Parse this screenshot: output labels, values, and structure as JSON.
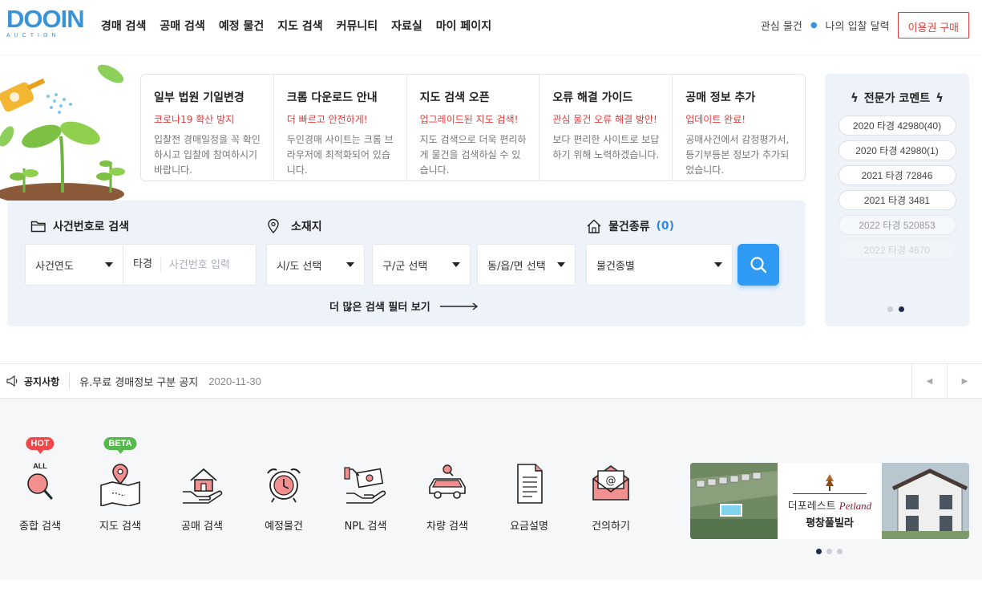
{
  "header": {
    "logo_text": "DOOIN",
    "logo_sub": "AUCTION",
    "nav": [
      "경매 검색",
      "공매 검색",
      "예정 물건",
      "지도 검색",
      "커뮤니티",
      "자료실",
      "마이 페이지"
    ],
    "link_favorites": "관심 물건",
    "link_calendar": "나의 입찰 달력",
    "buy_button": "이용권 구매"
  },
  "notice_cards": [
    {
      "title": "일부 법원 기일변경",
      "sub": "코로나19 확산 방지",
      "body": "입찰전 경매일정을 꼭 확인하시고 입찰에 참여하시기 바랍니다."
    },
    {
      "title": "크롬 다운로드 안내",
      "sub": "더 빠르고 안전하게!",
      "body": "두인경매 사이트는 크롬 브라우저에 최적화되어 있습니다."
    },
    {
      "title": "지도 검색 오픈",
      "sub": "업그레이드된 지도 검색!",
      "body": "지도 검색으로 더욱 편리하게 물건을 검색하실 수 있습니다."
    },
    {
      "title": "오류 해결 가이드",
      "sub": "관심 물건 오류 해결 방안!",
      "body": "보다 편리한 사이트로 보답하기 위해 노력하겠습니다."
    },
    {
      "title": "공매 정보 추가",
      "sub": "업데이트 완료!",
      "body": "공매사건에서 감정평가서, 등기부등본 정보가 추가되었습니다."
    }
  ],
  "expert": {
    "title": "전문가 코멘트",
    "cases": [
      "2020 타경 42980(40)",
      "2020 타경 42980(1)",
      "2021 타경 72846",
      "2021 타경 3481",
      "2022 타경 520853",
      "2022 타경 4670"
    ],
    "pager_active": 2,
    "pager_total": 2
  },
  "search": {
    "case_label": "사건번호로 검색",
    "location_label": "소재지",
    "type_label": "물건종류",
    "type_count": "(0)",
    "year_select": "사건연도",
    "tagyeong": "타경",
    "case_placeholder": "사건번호 입력",
    "sido_select": "시/도 선택",
    "gugun_select": "구/군 선택",
    "dong_select": "동/읍/면 선택",
    "type_select": "물건종별",
    "more_filters": "더 많은 검색 필터 보기"
  },
  "notice_bar": {
    "label": "공지사항",
    "text": "유.무료 경매정보 구분 공지",
    "date": "2020-11-30"
  },
  "quick_menu": {
    "badge_hot": "HOT",
    "badge_beta": "BETA",
    "all_text": "ALL",
    "items": [
      "종합 검색",
      "지도 검색",
      "공매 검색",
      "예정물건",
      "NPL 검색",
      "차량 검색",
      "요금설명",
      "건의하기"
    ]
  },
  "banner": {
    "brand_kr": "더포레스트",
    "brand_en": "Petland",
    "name": "평창풀빌라",
    "pager_active": 1,
    "pager_total": 3
  },
  "colors": {
    "brand": "#3a93d6",
    "accent_red": "#e0403b",
    "search_button": "#2e9af3",
    "panel_bg": "#eef3fa"
  }
}
